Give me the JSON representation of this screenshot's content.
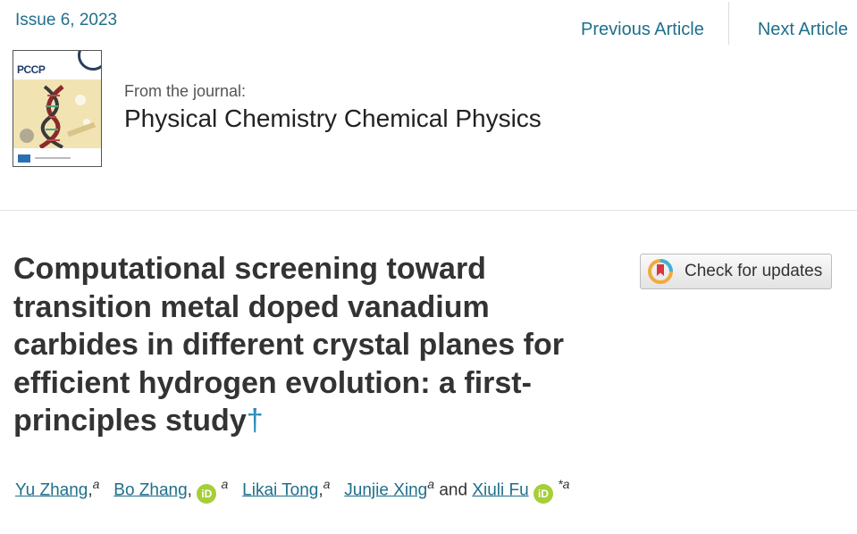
{
  "issue": "Issue 6, 2023",
  "nav": {
    "previous": "Previous Article",
    "next": "Next Article"
  },
  "cover": {
    "abbrev": "PCCP"
  },
  "journal": {
    "from_label": "From the journal:",
    "name": "Physical Chemistry Chemical Physics"
  },
  "article": {
    "title": "Computational screening toward transition metal doped vanadium carbides in different crystal planes for efficient hydrogen evolution: a first-principles study",
    "dagger": "†"
  },
  "check_updates": {
    "label": "Check for updates"
  },
  "authors": [
    {
      "name": "Yu Zhang",
      "affil": "a",
      "sep": ",",
      "orcid": false
    },
    {
      "name": "Bo Zhang",
      "affil": "a",
      "sep": ",",
      "orcid": true
    },
    {
      "name": "Likai Tong",
      "affil": "a",
      "sep": ",",
      "orcid": false
    },
    {
      "name": "Junjie Xing",
      "affil": "a",
      "sep": "",
      "orcid": false
    },
    {
      "name": "Xiuli Fu",
      "affil": "*a",
      "sep": "",
      "orcid": true
    }
  ],
  "authors_and": "and",
  "orcid_label": "iD",
  "colors": {
    "link": "#1f6f8b",
    "title": "#333333",
    "orcid": "#a6ce39",
    "dagger": "#2a8cba"
  }
}
